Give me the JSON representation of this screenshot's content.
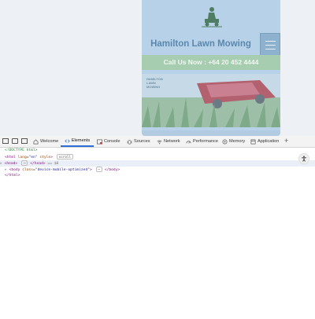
{
  "site": {
    "title": "Hamilton Lawn Mowing",
    "call_text": "Call Us Now : +64 20 452 4444",
    "hero_logo_text": "HAMILTON LAWN MOWING"
  },
  "devtools": {
    "tabs": [
      {
        "label": "Welcome",
        "icon": "home-icon"
      },
      {
        "label": "Elements",
        "icon": "code-icon",
        "active": true
      },
      {
        "label": "Console",
        "icon": "console-icon"
      },
      {
        "label": "Sources",
        "icon": "bug-icon"
      },
      {
        "label": "Network",
        "icon": "wifi-icon"
      },
      {
        "label": "Performance",
        "icon": "gauge-icon"
      },
      {
        "label": "Memory",
        "icon": "memory-icon"
      },
      {
        "label": "Application",
        "icon": "application-icon"
      }
    ],
    "plus_label": "+",
    "dom": {
      "doctype": "<!DOCTYPE html>",
      "html_open_tag": "html",
      "html_attr_lang": "lang",
      "html_attr_lang_val": "\"en\"",
      "html_attr_style": "style",
      "scroll_badge": "scroll",
      "head_line": "<head>",
      "head_collapsed": "⋯",
      "head_close": "</head>",
      "selected_marker": "== $0",
      "body_line_tag": "body",
      "body_attr": "class",
      "body_attr_val": "\"device-mobile-optimized\"",
      "body_collapsed": "⋯",
      "body_close": "</body>",
      "html_close": "</html>"
    }
  },
  "colors": {
    "active_tab": "#2b6fd6",
    "call_bar": "#a6cdb0",
    "site_title": "#5b87ad"
  }
}
